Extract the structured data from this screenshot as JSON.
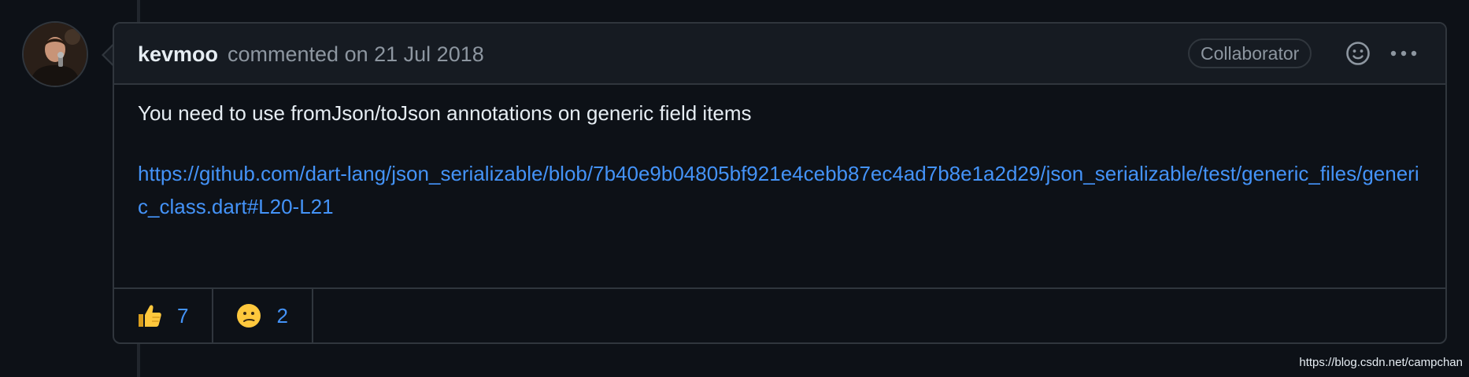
{
  "colors": {
    "background": "#0d1117",
    "header_background": "#161b22",
    "border": "#30363d",
    "text_primary": "#e6edf3",
    "text_muted": "#8d96a0",
    "link": "#4493f8"
  },
  "comment": {
    "avatar_icon": "user-avatar-photo",
    "author": "kevmoo",
    "action": "commented on",
    "date": "21 Jul 2018",
    "badge": "Collaborator",
    "reaction_picker_icon": "smiley-icon",
    "more_options_icon": "kebab-horizontal-icon",
    "body": {
      "text": "You need to use fromJson/toJson annotations on generic field items",
      "link": "https://github.com/dart-lang/json_serializable/blob/7b40e9b04805bf921e4cebb87ec4ad7b8e1a2d29/json_serializable/test/generic_files/generic_class.dart#L20-L21"
    },
    "reactions": [
      {
        "emoji": "thumbs-up-emoji",
        "count": "7"
      },
      {
        "emoji": "confused-face-emoji",
        "count": "2"
      }
    ]
  },
  "watermark": "https://blog.csdn.net/campchan"
}
